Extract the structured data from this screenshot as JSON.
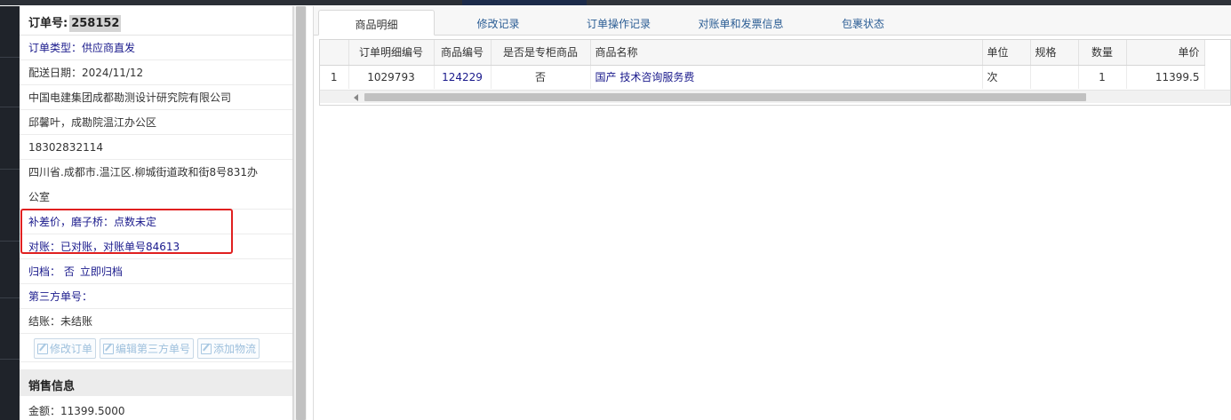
{
  "left_panel": {
    "order_label": "订单号:",
    "order_number": "258152",
    "rows": [
      {
        "text": "订单类型：供应商直发",
        "style": "blue"
      },
      {
        "text": "配送日期：2024/11/12",
        "style": "dark"
      },
      {
        "text": "中国电建集团成都勘测设计研究院有限公司",
        "style": "dark"
      },
      {
        "text": "邱馨叶，成勘院温江办公区",
        "style": "dark"
      },
      {
        "text": "18302832114",
        "style": "dark"
      }
    ],
    "address_line1": "四川省.成都市.温江区.柳城街道政和街8号831办",
    "address_line2": "公室",
    "price_diff_note": "补差价，磨子桥：点数未定",
    "reconcile_note": "对账：已对账，对账单号84613",
    "archive_label": "归档：  否",
    "archive_link": "立即归档",
    "third_party_label": "第三方单号：",
    "settlement_label": "结账：未结账",
    "buttons": {
      "edit_order": "修改订单",
      "edit_third_party": "编辑第三方单号",
      "add_logistics": "添加物流"
    },
    "sales_section_title": "销售信息",
    "amount_label": "金额：11399.5000"
  },
  "tabs": [
    {
      "label": "商品明细",
      "active": true
    },
    {
      "label": "修改记录",
      "active": false
    },
    {
      "label": "订单操作记录",
      "active": false
    },
    {
      "label": "对账单和发票信息",
      "active": false
    },
    {
      "label": "包裹状态",
      "active": false
    }
  ],
  "table": {
    "headers": [
      "",
      "订单明细编号",
      "商品编号",
      "是否是专柜商品",
      "商品名称",
      "单位",
      "规格",
      "数量",
      "单价"
    ],
    "rows": [
      [
        "1",
        "1029793",
        "124229",
        "否",
        "国产 技术咨询服务费",
        "次",
        "",
        "1",
        "11399.5"
      ]
    ]
  },
  "colors": {
    "link_blue": "#1a1a8c",
    "tab_blue": "#2c5e95",
    "highlight_red": "#e02020"
  }
}
